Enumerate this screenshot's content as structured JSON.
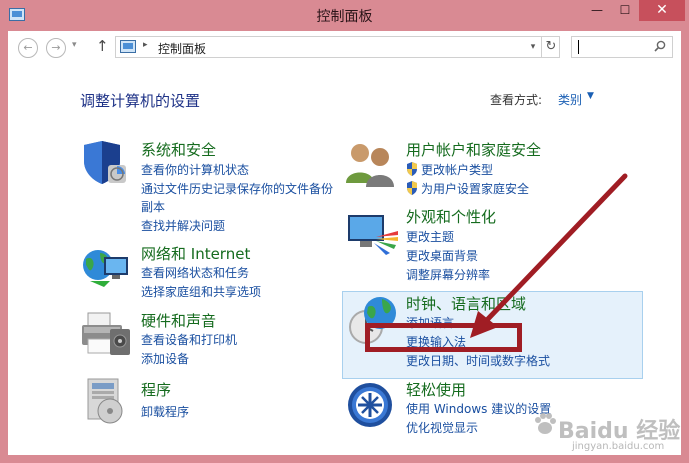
{
  "window": {
    "title": "控制面板",
    "minimize": "—",
    "maximize": "☐",
    "close": "✕"
  },
  "nav": {
    "back": "←",
    "forward": "→",
    "dropdown": "▾",
    "up": "↑",
    "breadcrumb_sep": "▸",
    "address": "控制面板",
    "address_dropdown": "▾",
    "refresh": "↻",
    "search_placeholder": ""
  },
  "main": {
    "heading": "调整计算机的设置",
    "view_by_label": "查看方式:",
    "view_by_value": "类别",
    "view_by_arrow": "▼"
  },
  "categories": [
    {
      "title": "系统和安全",
      "links": [
        "查看你的计算机状态",
        "通过文件历史记录保存你的文件备份",
        "副本",
        "查找并解决问题"
      ]
    },
    {
      "title": "网络和 Internet",
      "links": [
        "查看网络状态和任务",
        "选择家庭组和共享选项"
      ]
    },
    {
      "title": "硬件和声音",
      "links": [
        "查看设备和打印机",
        "添加设备"
      ]
    },
    {
      "title": "程序",
      "links": [
        "卸载程序"
      ]
    },
    {
      "title": "用户帐户和家庭安全",
      "links": [
        "更改帐户类型",
        "为用户设置家庭安全"
      ]
    },
    {
      "title": "外观和个性化",
      "links": [
        "更改主题",
        "更改桌面背景",
        "调整屏幕分辨率"
      ]
    },
    {
      "title": "时钟、语言和区域",
      "links": [
        "添加语言",
        "更换输入法",
        "更改日期、时间或数字格式"
      ]
    },
    {
      "title": "轻松使用",
      "links": [
        "使用 Windows 建议的设置",
        "优化视觉显示"
      ]
    }
  ],
  "watermark": {
    "main": "Baidu 经验",
    "sub": "jingyan.baidu.com"
  },
  "colors": {
    "titlebar": "#d98a93",
    "close_button": "#c7505c",
    "category_title": "#156b1e",
    "link": "#1a4fa0",
    "heading": "#1e3287",
    "highlight": "#e5f1fb",
    "annotation_red": "#a01d24"
  }
}
